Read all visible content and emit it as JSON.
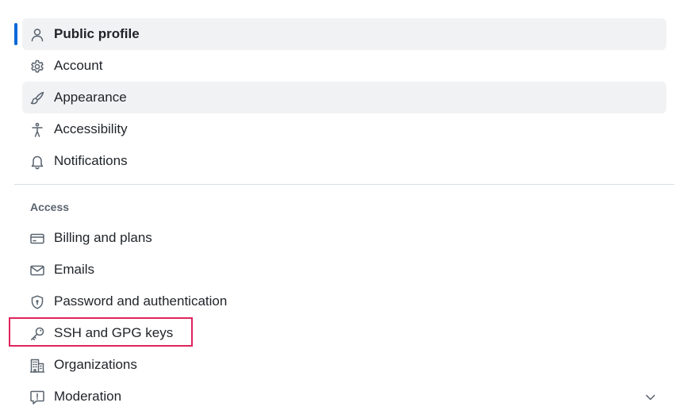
{
  "settings_nav": {
    "items": [
      {
        "label": "Public profile",
        "icon": "person-icon",
        "active": true
      },
      {
        "label": "Account",
        "icon": "gear-icon"
      },
      {
        "label": "Appearance",
        "icon": "paintbrush-icon"
      },
      {
        "label": "Accessibility",
        "icon": "accessibility-icon"
      },
      {
        "label": "Notifications",
        "icon": "bell-icon"
      }
    ],
    "access_group": {
      "heading": "Access",
      "items": [
        {
          "label": "Billing and plans",
          "icon": "credit-card-icon"
        },
        {
          "label": "Emails",
          "icon": "mail-icon"
        },
        {
          "label": "Password and authentication",
          "icon": "shield-lock-icon"
        },
        {
          "label": "SSH and GPG keys",
          "icon": "key-icon",
          "highlighted_by_focus_box": true
        },
        {
          "label": "Organizations",
          "icon": "organization-icon"
        },
        {
          "label": "Moderation",
          "icon": "report-icon",
          "expandable": true
        }
      ]
    }
  },
  "colors": {
    "active_indicator": "#0969da",
    "hover_background": "#f1f2f4",
    "focus_box": "#e0245e",
    "text": "#1f2328",
    "muted_text": "#59636e"
  }
}
